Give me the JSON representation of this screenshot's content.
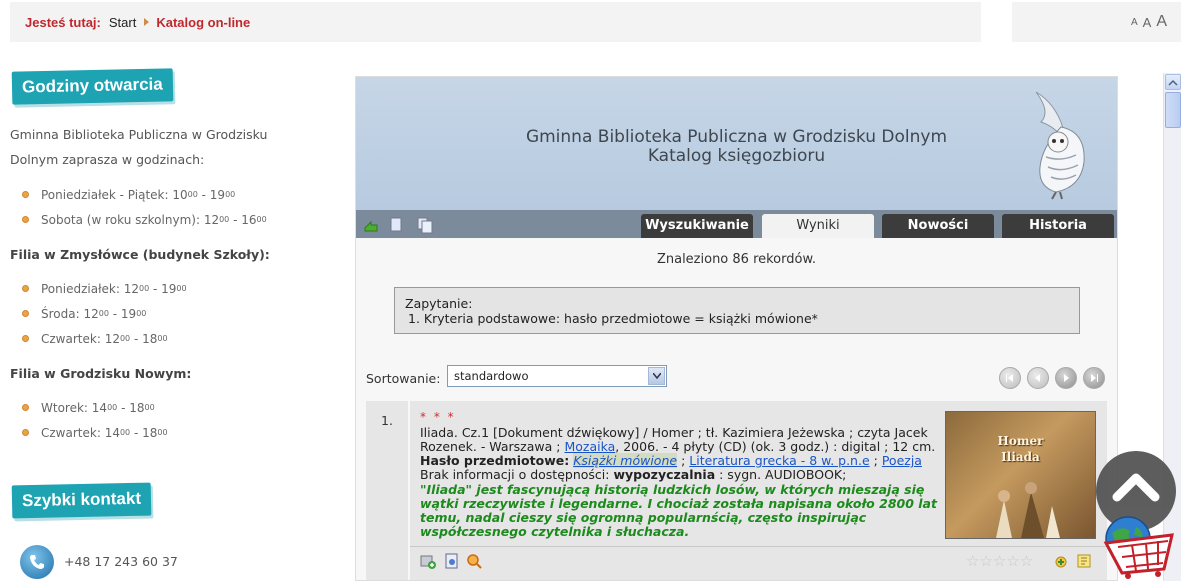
{
  "breadcrumb": {
    "label": "Jesteś tutaj:",
    "start": "Start",
    "current": "Katalog on-line"
  },
  "font_size": {
    "small": "A",
    "medium": "A",
    "large": "A"
  },
  "sidebar": {
    "hours_title": "Godziny otwarcia",
    "intro_line1": "Gminna Biblioteka Publiczna w Grodzisku",
    "intro_line2": "Dolnym zaprasza w godzinach:",
    "main_hours": [
      {
        "day": "Poniedziałek - Piątek:",
        "from": "10",
        "to": "19"
      },
      {
        "day": "Sobota (w roku szkolnym):",
        "from": "12",
        "to": "16"
      }
    ],
    "branch1_title": "Filia w Zmysłówce (budynek Szkoły):",
    "branch1_hours": [
      {
        "day": "Poniedziałek:",
        "from": "12",
        "to": "19"
      },
      {
        "day": "Środa:",
        "from": "12",
        "to": "19"
      },
      {
        "day": "Czwartek:",
        "from": "12",
        "to": "18"
      }
    ],
    "branch2_title": "Filia w Grodzisku Nowym:",
    "branch2_hours": [
      {
        "day": "Wtorek:",
        "from": "14",
        "to": "18"
      },
      {
        "day": "Czwartek:",
        "from": "14",
        "to": "18"
      }
    ],
    "sup": "00",
    "contact_title": "Szybki kontakt",
    "phone": "+48 17 243 60 37"
  },
  "catalog": {
    "title_line1": "Gminna Biblioteka Publiczna w Grodzisku Dolnym",
    "title_line2": "Katalog księgozbioru",
    "tabs": {
      "search": "Wyszukiwanie",
      "results": "Wyniki",
      "news": "Nowości",
      "history": "Historia"
    },
    "found": "Znaleziono 86 rekordów.",
    "query_label": "Zapytanie:",
    "query_text": "1. Kryteria podstawowe: hasło przedmiotowe = książki mówione*",
    "sort_label": "Sortowanie:",
    "sort_value": "standardowo"
  },
  "record": {
    "number": "1.",
    "stars": "* * *",
    "desc_a": "Iliada. Cz.1 [Dokument dźwiękowy] / Homer ; tł. Kazimiera Jeżewska ; czyta Jacek Rozenek. - Warszawa ;",
    "publisher": "Mozaika",
    "desc_b": ", 2006. - 4 płyty (CD) (ok. 3 godz.) : digital ; 12 cm.",
    "subject_label": "Hasło przedmiotowe:",
    "subject1": "Książki mówione",
    "sep": ";",
    "subject2": "Literatura grecka - 8 w. p.n.e",
    "subject3": "Poezja",
    "avail_a": "Brak informacji o dostępności:",
    "avail_b": "wypozyczalnia",
    "avail_c": ": sygn. AUDIOBOOK;",
    "annotation": "\"Iliada\" jest fascynującą historią ludzkich losów, w których mieszają się wątki rzeczywiste i legendarne. I chociaż została napisana około 2800 lat temu, nadal cieszy się ogromną popularnścią, często inspirując współczesnego czytelnika i słuchacza.",
    "cover_author": "Homer",
    "cover_title": "Iliada",
    "rating_stars": "☆☆☆☆☆"
  },
  "colors": {
    "accent_red": "#c0282d",
    "ribbon_teal": "#1ea3b3",
    "annotation_green": "#1c8a1c",
    "link_blue": "#1a55c8"
  }
}
